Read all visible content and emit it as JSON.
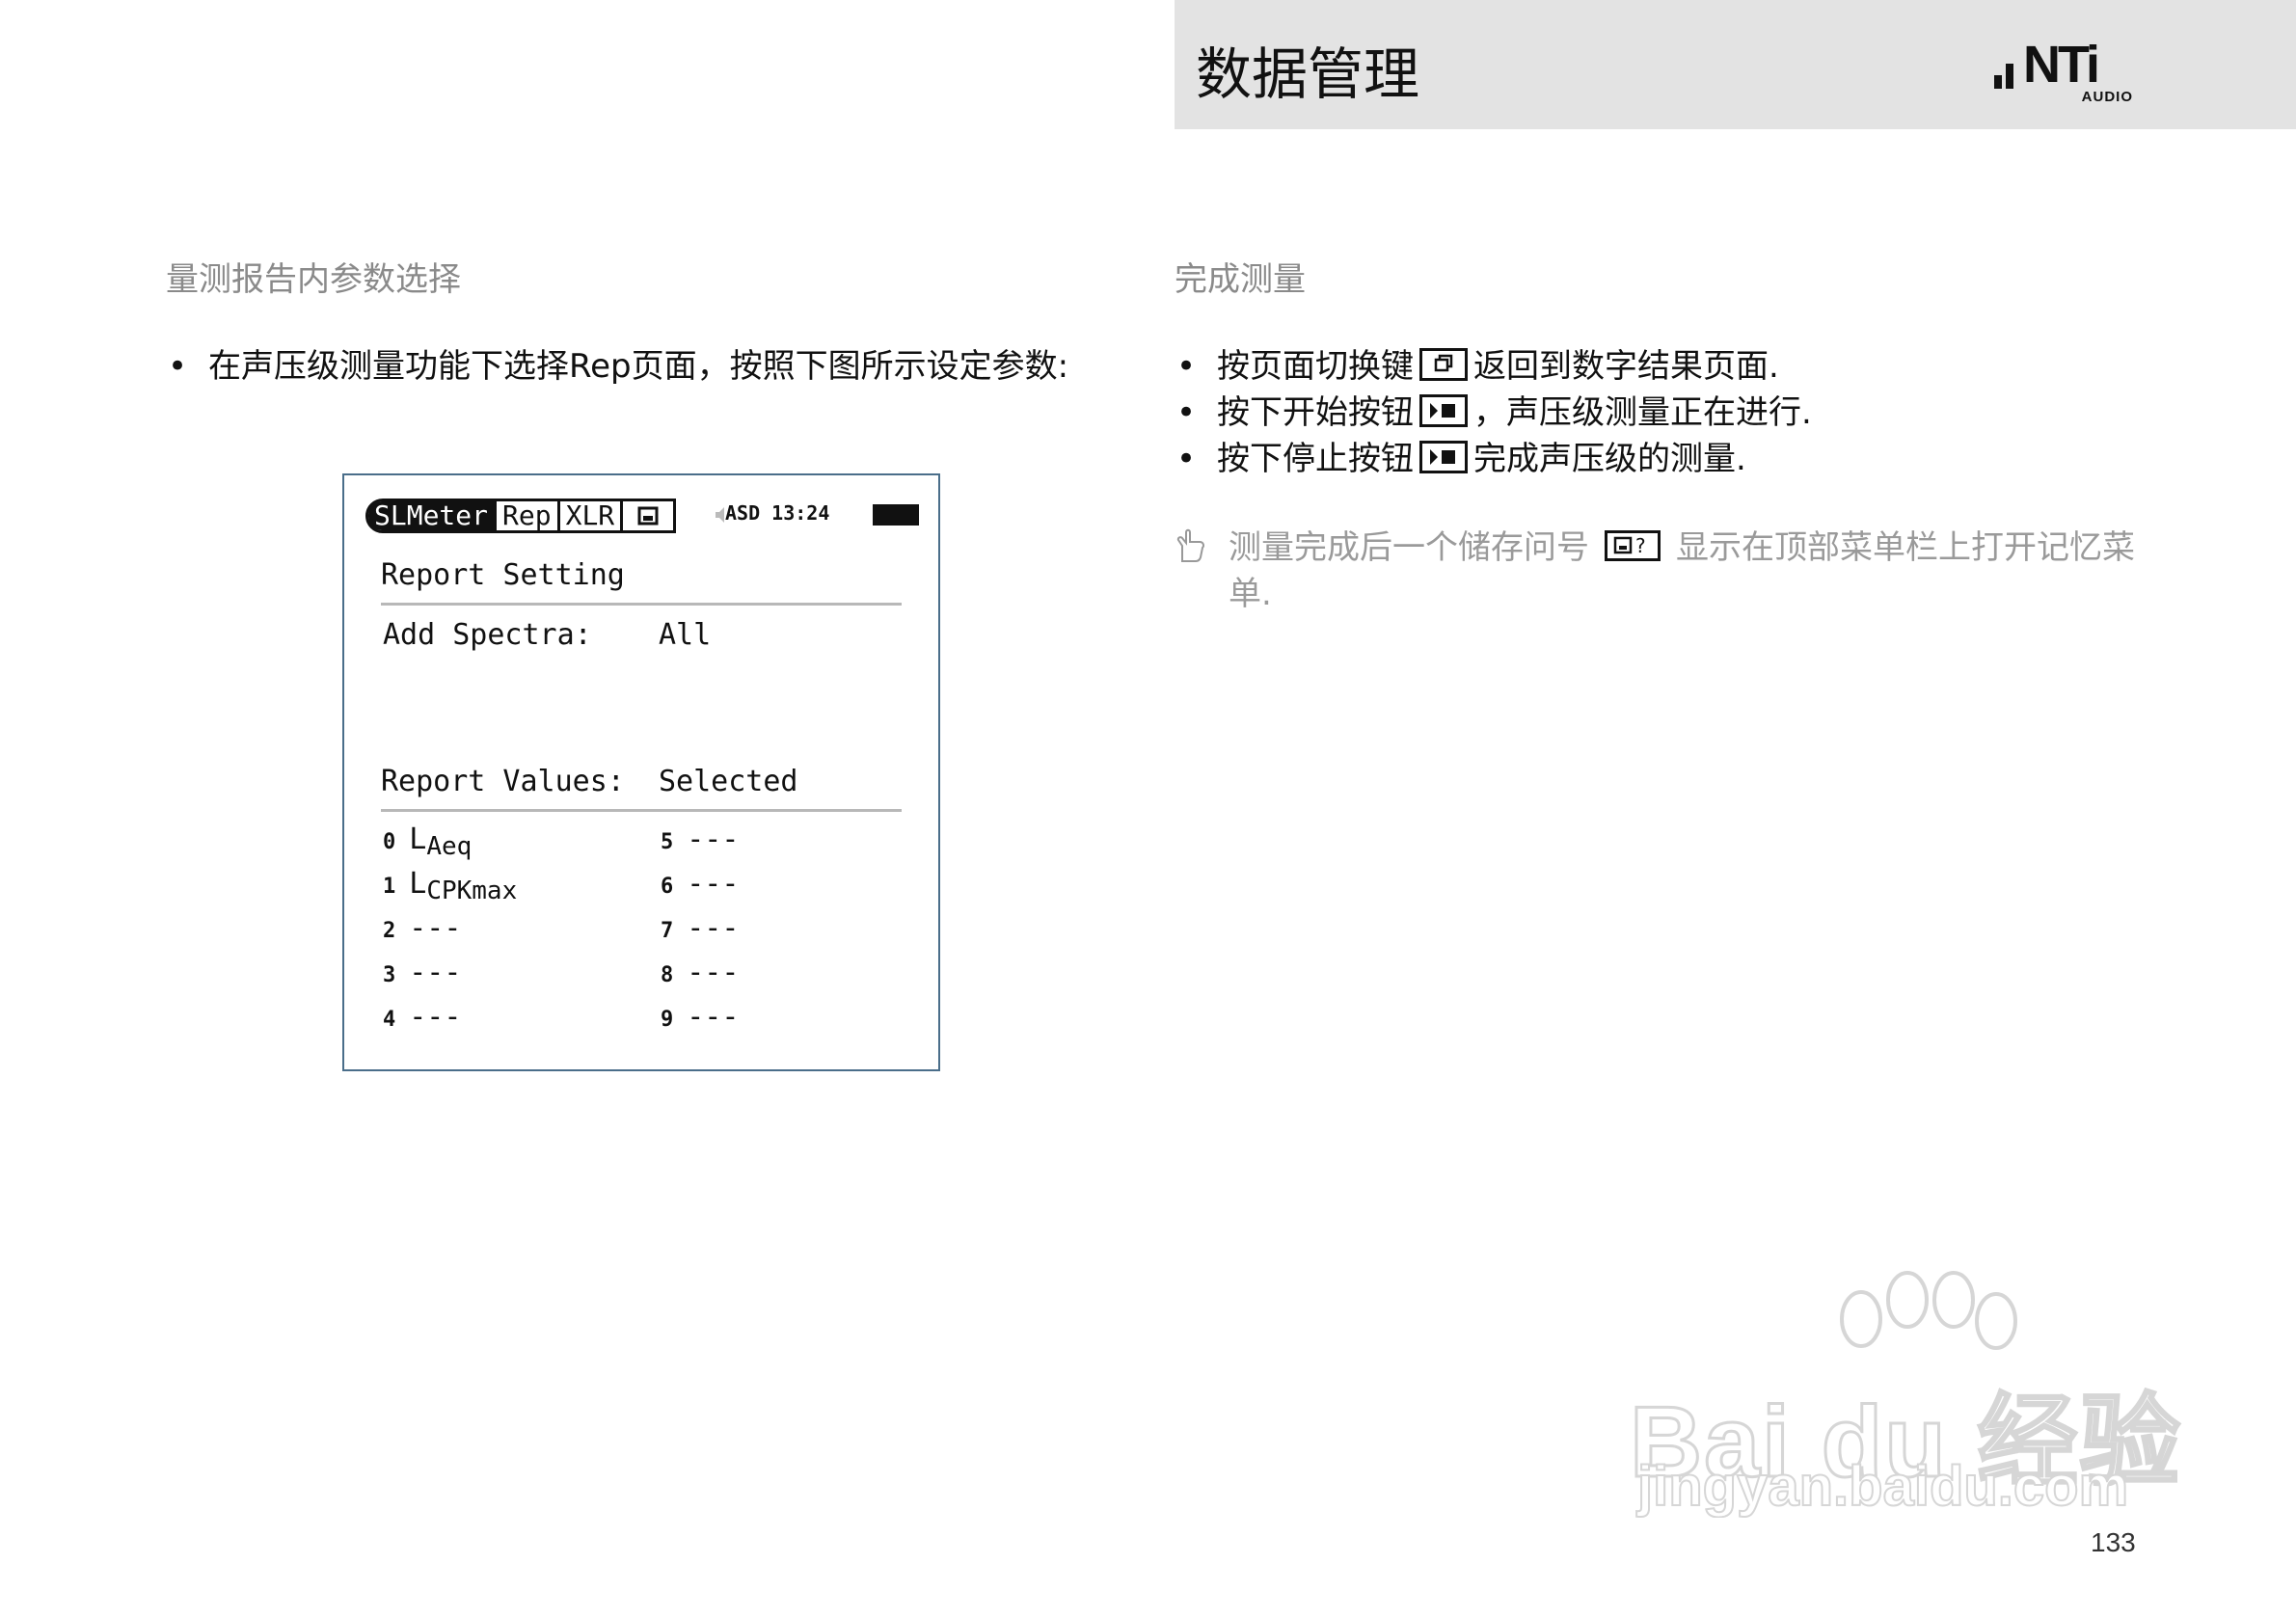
{
  "header": {
    "title": "数据管理",
    "logo_text": "NTi",
    "logo_sub": "AUDIO"
  },
  "left_section": {
    "heading": "量测报告内参数选择",
    "bullets": [
      "在声压级测量功能下选择Rep页面，按照下图所示设定参数:"
    ]
  },
  "device_screen": {
    "tabs": [
      "SLMeter",
      "Rep",
      "XLR"
    ],
    "save_tab_icon": "save-icon",
    "status": "ASD 13:24",
    "report_setting_label": "Report Setting",
    "add_spectra_label": "Add Spectra:",
    "add_spectra_value": "All",
    "report_values_label": "Report Values:",
    "report_values_value": "Selected",
    "values_left": [
      {
        "index": "0",
        "main": "L",
        "sub": "Aeq"
      },
      {
        "index": "1",
        "main": "L",
        "sub": "CPKmax"
      },
      {
        "index": "2",
        "main": "---",
        "sub": ""
      },
      {
        "index": "3",
        "main": "---",
        "sub": ""
      },
      {
        "index": "4",
        "main": "---",
        "sub": ""
      }
    ],
    "values_right": [
      {
        "index": "5",
        "main": "---"
      },
      {
        "index": "6",
        "main": "---"
      },
      {
        "index": "7",
        "main": "---"
      },
      {
        "index": "8",
        "main": "---"
      },
      {
        "index": "9",
        "main": "---"
      }
    ]
  },
  "right_section": {
    "heading": "完成测量",
    "bullets": [
      {
        "before": "按页面切换键",
        "icon": "page-switch-icon",
        "after": "返回到数字结果页面."
      },
      {
        "before": "按下开始按钮",
        "icon": "start-stop-icon",
        "after": "，声压级测量正在进行."
      },
      {
        "before": "按下停止按钮",
        "icon": "start-stop-icon",
        "after": "完成声压级的测量."
      }
    ],
    "note": {
      "icon": "hand-pointer-icon",
      "before": "测量完成后一个储存问号",
      "inline_icon": "save-question-icon",
      "after": "显示在顶部菜单栏上打开记忆菜单."
    }
  },
  "watermark": {
    "main": "Bai du 经验",
    "sub": "jingyan.baidu.com"
  },
  "page_number": "133"
}
